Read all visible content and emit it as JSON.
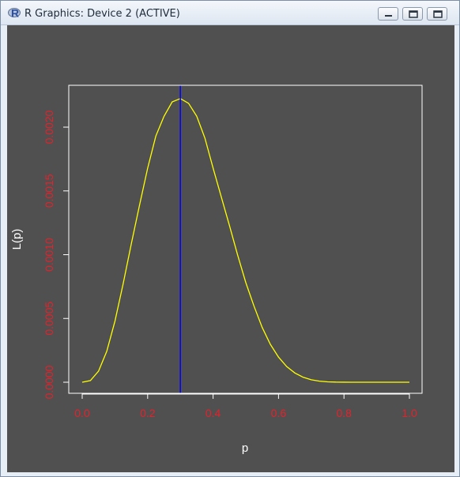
{
  "window": {
    "title": "R Graphics: Device 2 (ACTIVE)",
    "buttons": [
      "minimize",
      "restore",
      "close"
    ]
  },
  "icons": {
    "app": "r-logo-icon",
    "minimize": "minimize-icon",
    "restore": "restore-icon",
    "close": "close-icon"
  },
  "colors": {
    "background": "#505050",
    "curve": "#ffff00",
    "vline": "#0000ff",
    "ytick": "#e8202a",
    "xtick": "#e8202a",
    "axis_labels": "#ffffff",
    "box": "#ffffff"
  },
  "chart_data": {
    "type": "line",
    "xlabel": "p",
    "ylabel": "L(p)",
    "xlim": [
      0,
      1
    ],
    "ylim": [
      -7e-05,
      0.00232
    ],
    "x_ticks": [
      "0.0",
      "0.2",
      "0.4",
      "0.6",
      "0.8",
      "1.0"
    ],
    "y_ticks": [
      "0.0000",
      "0.0005",
      "0.0010",
      "0.0015",
      "0.0020"
    ],
    "x_tick_values": [
      0,
      0.2,
      0.4,
      0.6,
      0.8,
      1.0
    ],
    "y_tick_values": [
      0,
      0.0005,
      0.001,
      0.0015,
      0.002
    ],
    "function": "p^3 * (1-p)^7",
    "series": [
      {
        "x": [
          0,
          0.025,
          0.05,
          0.075,
          0.1,
          0.125,
          0.15,
          0.175,
          0.2,
          0.225,
          0.25,
          0.275,
          0.3,
          0.325,
          0.35,
          0.375,
          0.4,
          0.425,
          0.45,
          0.475,
          0.5,
          0.525,
          0.55,
          0.575,
          0.6,
          0.625,
          0.65,
          0.675,
          0.7,
          0.725,
          0.75,
          0.775,
          0.8,
          0.825,
          0.85,
          0.875,
          0.9,
          0.925,
          0.95,
          0.975,
          1.0
        ],
        "values": [
          0,
          1.31e-05,
          8.74e-05,
          0.000242,
          0.000478,
          0.00077,
          0.001084,
          0.001386,
          0.001678,
          0.00193,
          0.002085,
          0.002198,
          0.002224,
          0.002187,
          0.002086,
          0.001914,
          0.001679,
          0.001453,
          0.001229,
          0.000997,
          0.000781,
          0.000597,
          0.00043,
          0.000297,
          0.000197,
          0.000123,
          7.26e-05,
          3.93e-05,
          1.94e-05,
          8.55e-06,
          3.3e-06,
          1.07e-06,
          2.62e-07,
          4.55e-08,
          3.9e-09,
          1e-10,
          0,
          0,
          0,
          0,
          0
        ]
      }
    ],
    "vline": {
      "x": 0.3
    }
  }
}
